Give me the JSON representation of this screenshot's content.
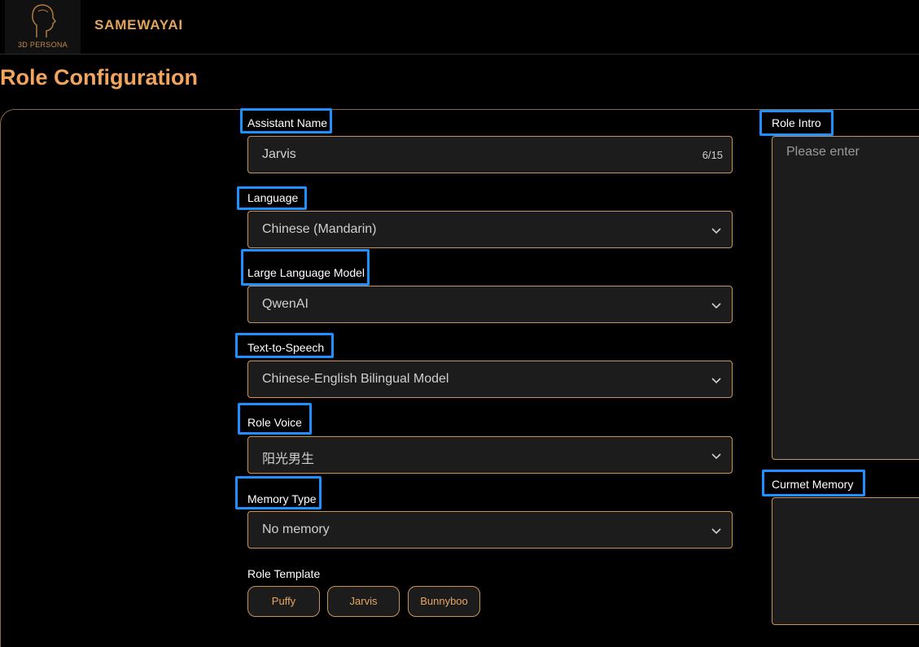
{
  "header": {
    "logo_text": "3D PERSONA",
    "brand": "SAMEWAYAI"
  },
  "page": {
    "title": "Role Configuration"
  },
  "form": {
    "assistant_name": {
      "label": "Assistant Name",
      "value": "Jarvis",
      "counter": "6/15"
    },
    "language": {
      "label": "Language",
      "value": "Chinese (Mandarin)"
    },
    "llm": {
      "label": "Large Language Model",
      "value": "QwenAI"
    },
    "tts": {
      "label": "Text-to-Speech",
      "value": "Chinese-English Bilingual Model"
    },
    "voice": {
      "label": "Role Voice",
      "value": "阳光男生"
    },
    "memory_type": {
      "label": "Memory Type",
      "value": "No memory"
    },
    "role_template": {
      "label": "Role Template",
      "options": [
        "Puffy",
        "Jarvis",
        "Bunnyboo"
      ]
    },
    "role_intro": {
      "label": "Role Intro",
      "placeholder": "Please enter"
    },
    "current_memory": {
      "label": "Curmet Memory"
    }
  },
  "colors": {
    "accent": "#f3a55f",
    "border": "#c8935a",
    "highlight": "#1e90ff",
    "field_bg": "#1c1c1c"
  }
}
